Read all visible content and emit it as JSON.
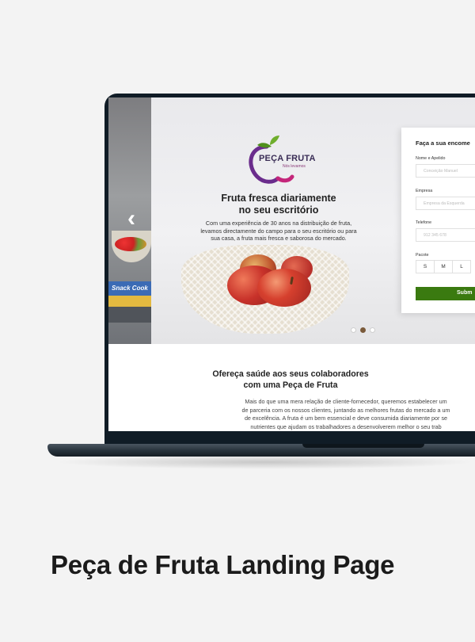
{
  "logo": {
    "brand": "PEÇA FRUTA",
    "tagline": "Nós levamos",
    "colors": {
      "purple": "#6a2c8c",
      "magenta": "#c4267a",
      "leaf": "#6fae2c"
    }
  },
  "hero": {
    "title_line1": "Fruta fresca diariamente",
    "title_line2": "no seu escritório",
    "desc_line1": "Com uma experiência de 30 anos na distribuição de fruta,",
    "desc_line2": "levamos directamente do campo para o seu escritório ou para",
    "desc_line3": "sua casa, a fruta mais fresca e saborosa do mercado.",
    "prev_icon": "‹",
    "side_book_text": "Snack Cook",
    "carousel_active_index": 1,
    "carousel_count": 3
  },
  "form": {
    "title": "Faça a sua encome",
    "name_label": "Nome e Apelido",
    "name_placeholder": "Conceição Manuel",
    "company_label": "Empresa",
    "company_placeholder": "Empresa da Esquerda",
    "phone_label": "Telefone",
    "phone_placeholder": "912 345 678",
    "package_label": "Pacote",
    "sizes": [
      "S",
      "M",
      "L"
    ],
    "submit_label": "Subm",
    "accent_color": "#3a7a10"
  },
  "section": {
    "title_line1": "Ofereça saúde aos seus colaboradores",
    "title_line2": "com uma Peça de Fruta",
    "body_line1": "Mais do que uma mera relação de cliente-fornecedor, queremos estabelecer um",
    "body_line2": "de parceria com os nossos clientes, juntando as melhores frutas do mercado a um",
    "body_line3": "de excelência. A fruta é um bem essencial e deve consumida diariamente por se",
    "body_line4": "nutrientes que ajudam os trabalhadores a desenvolverem melhor o seu trab"
  },
  "caption": "Peça de Fruta Landing Page"
}
